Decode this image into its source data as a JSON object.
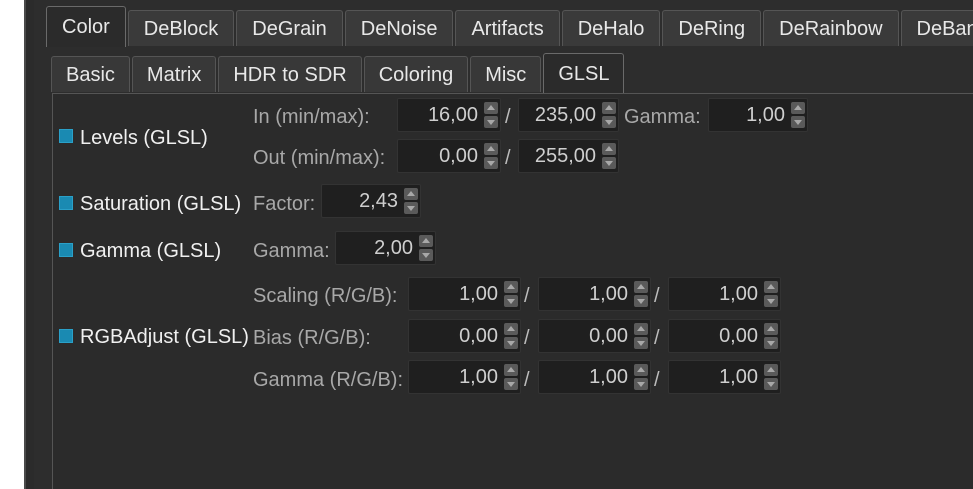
{
  "tabs_top": [
    "Color",
    "DeBlock",
    "DeGrain",
    "DeNoise",
    "Artifacts",
    "DeHalo",
    "DeRing",
    "DeRainbow",
    "DeBand"
  ],
  "tabs_sub": [
    "Basic",
    "Matrix",
    "HDR to SDR",
    "Coloring",
    "Misc",
    "GLSL"
  ],
  "levels": {
    "label": "Levels (GLSL)",
    "in_label": "In (min/max):",
    "in_min": "16,00",
    "in_max": "235,00",
    "gamma_label": "Gamma:",
    "gamma": "1,00",
    "out_label": "Out (min/max):",
    "out_min": "0,00",
    "out_max": "255,00"
  },
  "saturation": {
    "label": "Saturation (GLSL)",
    "factor_label": "Factor:",
    "factor": "2,43"
  },
  "gamma": {
    "label": "Gamma (GLSL)",
    "gamma_label": "Gamma:",
    "gamma": "2,00"
  },
  "rgbadjust": {
    "label": "RGBAdjust (GLSL)",
    "scaling_label": "Scaling (R/G/B):",
    "scaling": [
      "1,00",
      "1,00",
      "1,00"
    ],
    "bias_label": "Bias (R/G/B):",
    "bias": [
      "0,00",
      "0,00",
      "0,00"
    ],
    "gamma_label": "Gamma (R/G/B):",
    "gamma": [
      "1,00",
      "1,00",
      "1,00"
    ]
  },
  "slash": "/",
  "colors": {
    "checkbox": "#1a8ab2",
    "background": "#2b2b2b",
    "field": "#1f1f1f"
  }
}
